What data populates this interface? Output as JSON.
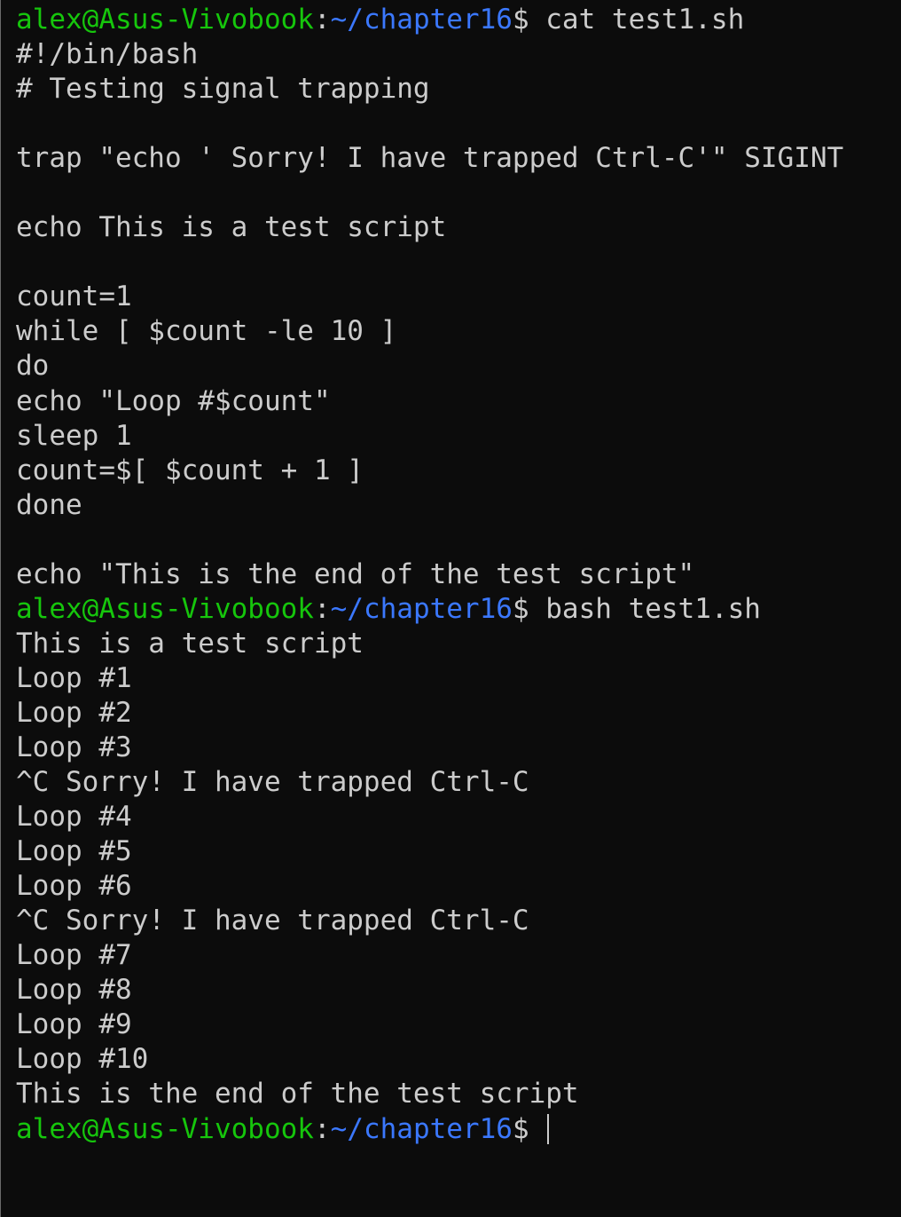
{
  "prompt": {
    "user_host": "alex@Asus-Vivobook",
    "separator": ":",
    "path": "~/chapter16",
    "symbol": "$ "
  },
  "blocks": [
    {
      "command": "cat test1.sh",
      "output": [
        "#!/bin/bash",
        "# Testing signal trapping",
        "",
        "trap \"echo ' Sorry! I have trapped Ctrl-C'\" SIGINT",
        "",
        "echo This is a test script",
        "",
        "count=1",
        "while [ $count -le 10 ]",
        "do",
        "echo \"Loop #$count\"",
        "sleep 1",
        "count=$[ $count + 1 ]",
        "done",
        "",
        "echo \"This is the end of the test script\""
      ]
    },
    {
      "command": "bash test1.sh",
      "output": [
        "This is a test script",
        "Loop #1",
        "Loop #2",
        "Loop #3",
        "^C Sorry! I have trapped Ctrl-C",
        "Loop #4",
        "Loop #5",
        "Loop #6",
        "^C Sorry! I have trapped Ctrl-C",
        "Loop #7",
        "Loop #8",
        "Loop #9",
        "Loop #10",
        "This is the end of the test script"
      ]
    }
  ],
  "colors": {
    "background": "#0c0c0c",
    "foreground": "#cccccc",
    "user_host": "#16c60c",
    "path": "#3b78ff"
  }
}
